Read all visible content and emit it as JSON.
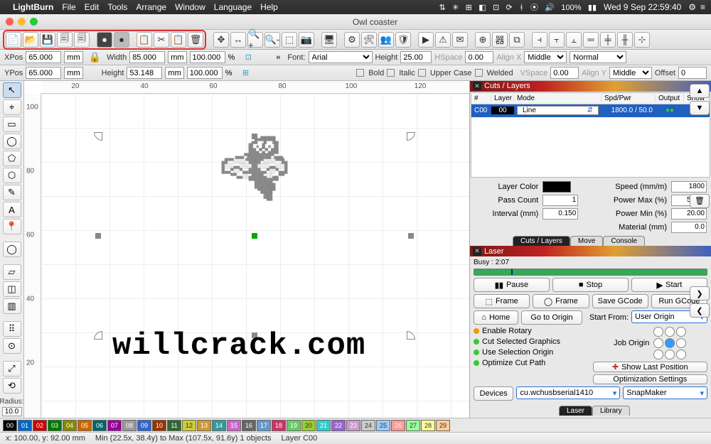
{
  "menubar": {
    "app_name": "LightBurn",
    "items": [
      "File",
      "Edit",
      "Tools",
      "Arrange",
      "Window",
      "Language",
      "Help"
    ],
    "tray_icons": [
      "⇅",
      "✳",
      "⊞",
      "◧",
      "⊡",
      "⊡",
      "ᚼ",
      "⦿",
      "⟳",
      "◑",
      "🔊"
    ],
    "battery": "100%",
    "battery_icon": "▮▮",
    "clock": "Wed 9 Sep  22:59:40",
    "extra": [
      "⚙",
      "≡"
    ]
  },
  "window": {
    "title": "Owl coaster"
  },
  "toolbar": {
    "group_file": [
      "📄",
      "📂",
      "💾",
      "🗐",
      "🗐"
    ],
    "group_undo": [
      "●",
      "●"
    ],
    "group_clip": [
      "📋",
      "✂",
      "📋",
      "🗑"
    ],
    "group_view": [
      "✥",
      "↔",
      "🔍+",
      "🔍-",
      "⬚",
      "📷"
    ],
    "group_mon": [
      "🖥"
    ],
    "group_set": [
      "⚙",
      "🛠",
      "👥",
      "🛡"
    ],
    "group_send": [
      "▶",
      "⚠",
      "✉"
    ],
    "group_arr": [
      "⊕",
      "器",
      "⧉"
    ],
    "group_align": [
      "⫞",
      "⫟",
      "⫠",
      "═",
      "╪",
      "╫",
      "⊹"
    ]
  },
  "props": {
    "xpos_label": "XPos",
    "xpos": "65.000",
    "xunit": "mm",
    "ypos_label": "YPos",
    "ypos": "65.000",
    "yunit": "mm",
    "width_label": "Width",
    "width": "85.000",
    "wunit": "mm",
    "wpct": "100.000",
    "pct": "%",
    "height_label": "Height",
    "height": "53.148",
    "hunit": "mm",
    "hpct": "100.000",
    "font_label": "Font:",
    "font": "Arial",
    "fh_label": "Height",
    "fh": "25.00",
    "hspace_label": "HSpace",
    "hspace": "0.00",
    "alignx_label": "Align X",
    "alignx": "Middle",
    "style": "Normal",
    "bold": "Bold",
    "italic": "Italic",
    "upper": "Upper Case",
    "welded": "Welded",
    "vspace_label": "VSpace",
    "vspace": "0.00",
    "aligny_label": "Align Y",
    "aligny": "Middle",
    "offset_label": "Offset",
    "offset": "0"
  },
  "left_tools": {
    "items": [
      "↖",
      "⌖",
      "▭",
      "◯",
      "⬠",
      "⬡",
      "✎",
      "A",
      "📍",
      "",
      "◯",
      "",
      "▱",
      "◫",
      "▥",
      "",
      "⠿",
      "⊙",
      "",
      "⤢",
      "⟲"
    ],
    "radius_label": "Radius:",
    "radius": "10.0"
  },
  "ruler": {
    "top": [
      "20",
      "40",
      "60",
      "80",
      "100",
      "120"
    ],
    "left": [
      "20",
      "40",
      "60",
      "80",
      "100"
    ]
  },
  "watermark": "willcrack.com",
  "cuts": {
    "title": "Cuts / Layers",
    "cols": [
      "#",
      "Layer",
      "Mode",
      "Spd/Pwr",
      "Output",
      "Show"
    ],
    "row": {
      "id": "C00",
      "layer": "00",
      "mode": "Line",
      "spdpwr": "1800.0 / 50.0",
      "output": "●",
      "show": "●"
    },
    "side": [
      "▲",
      "▼",
      "",
      "🗑",
      "",
      "❯",
      "❮"
    ],
    "p_layercolor": "Layer Color",
    "p_speed": "Speed (mm/m)",
    "speed": "1800",
    "p_pass": "Pass Count",
    "pass": "1",
    "p_pmax": "Power Max (%)",
    "pmax": "50.00",
    "p_interval": "Interval (mm)",
    "interval": "0.150",
    "p_pmin": "Power Min (%)",
    "pmin": "20.00",
    "p_material": "Material (mm)",
    "material": "0.0",
    "tabs": [
      "Cuts / Layers",
      "Move",
      "Console"
    ]
  },
  "laser": {
    "title": "Laser",
    "busy": "Busy : 2:07",
    "pause": "Pause",
    "stop": "Stop",
    "start": "Start",
    "frame1": "Frame",
    "frame2": "Frame",
    "savegc": "Save GCode",
    "rungc": "Run GCode",
    "home": "Home",
    "goorigin": "Go to Origin",
    "startfrom_label": "Start From:",
    "startfrom": "User Origin",
    "joborigin_label": "Job Origin",
    "enable_rotary": "Enable Rotary",
    "cut_sel": "Cut Selected Graphics",
    "use_sel": "Use Selection Origin",
    "opt_path": "Optimize Cut Path",
    "show_last": "Show Last Position",
    "opt_set": "Optimization Settings",
    "devices": "Devices",
    "port": "cu.wchusbserial1410",
    "machine": "SnapMaker",
    "tabs": [
      "Laser",
      "Library"
    ]
  },
  "palette": [
    {
      "c": "#000",
      "n": "00"
    },
    {
      "c": "#06c",
      "n": "01"
    },
    {
      "c": "#c00",
      "n": "02"
    },
    {
      "c": "#070",
      "n": "03"
    },
    {
      "c": "#880",
      "n": "04"
    },
    {
      "c": "#c60",
      "n": "05"
    },
    {
      "c": "#066",
      "n": "06"
    },
    {
      "c": "#909",
      "n": "07"
    },
    {
      "c": "#999",
      "n": "08"
    },
    {
      "c": "#36c",
      "n": "09"
    },
    {
      "c": "#930",
      "n": "10"
    },
    {
      "c": "#363",
      "n": "11"
    },
    {
      "c": "#cc3",
      "n": "12"
    },
    {
      "c": "#c93",
      "n": "13"
    },
    {
      "c": "#399",
      "n": "14"
    },
    {
      "c": "#c6c",
      "n": "15"
    },
    {
      "c": "#666",
      "n": "16"
    },
    {
      "c": "#69c",
      "n": "17"
    },
    {
      "c": "#c36",
      "n": "18"
    },
    {
      "c": "#6c6",
      "n": "19"
    },
    {
      "c": "#9c3",
      "n": "20"
    },
    {
      "c": "#3cc",
      "n": "21"
    },
    {
      "c": "#96c",
      "n": "22"
    },
    {
      "c": "#c9c",
      "n": "23"
    },
    {
      "c": "#ccc",
      "n": "24"
    },
    {
      "c": "#9cf",
      "n": "25"
    },
    {
      "c": "#f99",
      "n": "26"
    },
    {
      "c": "#9f9",
      "n": "27"
    },
    {
      "c": "#ff9",
      "n": "28"
    },
    {
      "c": "#fc9",
      "n": "29"
    }
  ],
  "status": {
    "pos": "x: 100.00, y: 92.00 mm",
    "bounds": "Min (22.5x, 38.4y) to Max (107.5x, 91.6y)  1 objects",
    "layer": "Layer C00"
  }
}
